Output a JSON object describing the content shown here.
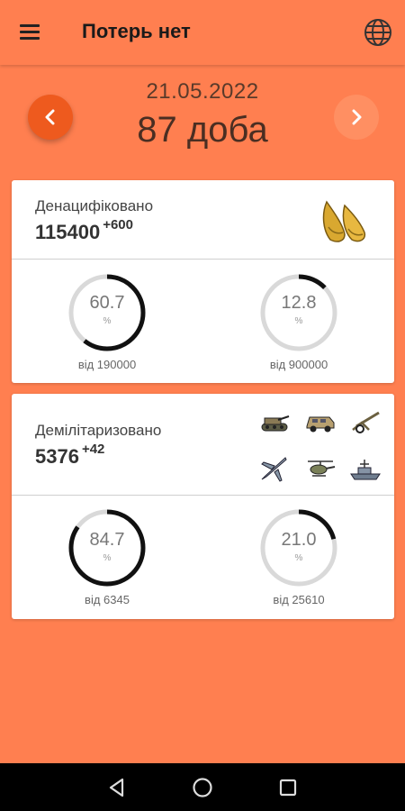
{
  "app": {
    "title": "Потерь нет"
  },
  "date": "21.05.2022",
  "day": "87 доба",
  "cards": [
    {
      "label": "Денацифіковано",
      "value": "115400",
      "delta": "+600",
      "rings": [
        {
          "value": "60.7",
          "unit": "%",
          "base": "від 190000",
          "fraction": 0.607
        },
        {
          "value": "12.8",
          "unit": "%",
          "base": "від 900000",
          "fraction": 0.128
        }
      ]
    },
    {
      "label": "Демілітаризовано",
      "value": "5376",
      "delta": "+42",
      "icons": [
        "tank-icon",
        "armored-vehicle-icon",
        "artillery-icon",
        "jet-icon",
        "helicopter-icon",
        "ship-icon"
      ],
      "rings": [
        {
          "value": "84.7",
          "unit": "%",
          "base": "від 6345",
          "fraction": 0.847
        },
        {
          "value": "21.0",
          "unit": "%",
          "base": "від 25610",
          "fraction": 0.21
        }
      ]
    }
  ],
  "colors": {
    "background": "#ff7f50",
    "prev_button": "#ee5a1e",
    "ring_track": "#d9d9d9",
    "ring_fill": "#111111"
  }
}
